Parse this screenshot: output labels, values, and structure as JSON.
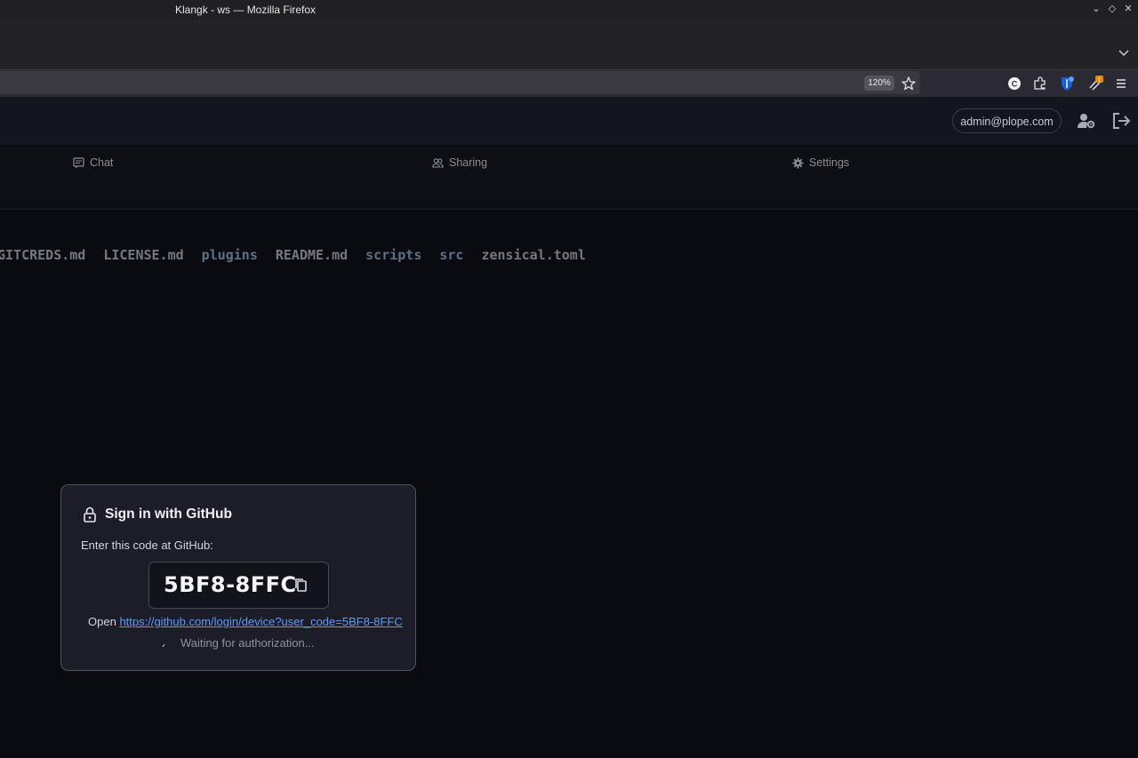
{
  "window": {
    "title": "Klangk - ws — Mozilla Firefox",
    "controls": {
      "minimize": "⌄",
      "maximize": "◇",
      "close": "✕"
    }
  },
  "browser": {
    "zoom": "120%",
    "icons": [
      "bookmark-star-icon",
      "extension-c-icon",
      "puzzle-icon",
      "bitwarden-icon",
      "extension-badge-icon",
      "menu-hamburger-icon"
    ],
    "extension_badge_count": "1"
  },
  "header": {
    "user_email": "admin@plope.com",
    "icons": [
      "user-settings-icon",
      "logout-icon"
    ]
  },
  "tabs": [
    {
      "label": "Chat",
      "icon": "chat-icon"
    },
    {
      "label": "Sharing",
      "icon": "people-icon"
    },
    {
      "label": "Settings",
      "icon": "gear-icon"
    }
  ],
  "files": [
    {
      "name": "GITCREDS.md",
      "type": "file"
    },
    {
      "name": "LICENSE.md",
      "type": "file"
    },
    {
      "name": "plugins",
      "type": "dir"
    },
    {
      "name": "README.md",
      "type": "file"
    },
    {
      "name": "scripts",
      "type": "dir"
    },
    {
      "name": "src",
      "type": "dir"
    },
    {
      "name": "zensical.toml",
      "type": "file"
    }
  ],
  "dialog": {
    "title": "Sign in with GitHub",
    "instruction": "Enter this code at GitHub:",
    "code": "5BF8-8FFC",
    "open_label": "Open",
    "link": "https://github.com/login/device?user_code=5BF8-8FFC",
    "status": "Waiting for authorization..."
  },
  "colors": {
    "background": "#0a0b10",
    "dialog_bg": "#1c1d29",
    "link": "#5b9aff",
    "dir": "#5d7184"
  }
}
